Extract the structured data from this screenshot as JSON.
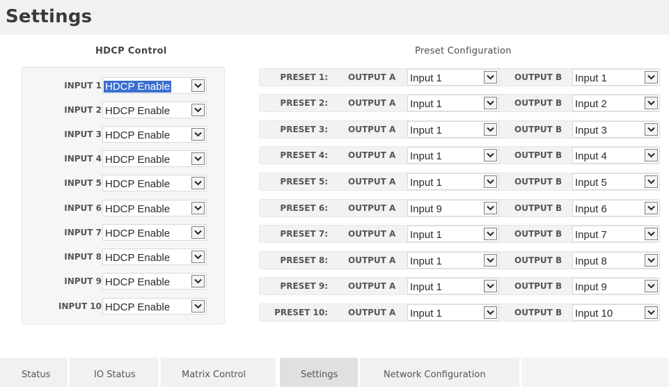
{
  "page": {
    "title": "Settings"
  },
  "hdcp": {
    "title": "HDCP Control",
    "rows": [
      {
        "label": "INPUT 1",
        "value": "HDCP Enable"
      },
      {
        "label": "INPUT 2",
        "value": "HDCP Enable"
      },
      {
        "label": "INPUT 3",
        "value": "HDCP Enable"
      },
      {
        "label": "INPUT 4",
        "value": "HDCP Enable"
      },
      {
        "label": "INPUT 5",
        "value": "HDCP Enable"
      },
      {
        "label": "INPUT 6",
        "value": "HDCP Enable"
      },
      {
        "label": "INPUT 7",
        "value": "HDCP Enable"
      },
      {
        "label": "INPUT 8",
        "value": "HDCP Enable"
      },
      {
        "label": "INPUT 9",
        "value": "HDCP Enable"
      },
      {
        "label": "INPUT 10",
        "value": "HDCP Enable"
      }
    ]
  },
  "preset": {
    "title": "Preset Configuration",
    "output_a_label": "OUTPUT A",
    "output_b_label": "OUTPUT B",
    "rows": [
      {
        "label": "PRESET 1:",
        "output_a": "Input 1",
        "output_b": "Input 1"
      },
      {
        "label": "PRESET 2:",
        "output_a": "Input 1",
        "output_b": "Input 2"
      },
      {
        "label": "PRESET 3:",
        "output_a": "Input 1",
        "output_b": "Input 3"
      },
      {
        "label": "PRESET 4:",
        "output_a": "Input 1",
        "output_b": "Input 4"
      },
      {
        "label": "PRESET 5:",
        "output_a": "Input 1",
        "output_b": "Input 5"
      },
      {
        "label": "PRESET 6:",
        "output_a": "Input 9",
        "output_b": "Input 6"
      },
      {
        "label": "PRESET 7:",
        "output_a": "Input 1",
        "output_b": "Input 7"
      },
      {
        "label": "PRESET 8:",
        "output_a": "Input 1",
        "output_b": "Input 8"
      },
      {
        "label": "PRESET 9:",
        "output_a": "Input 1",
        "output_b": "Input 9"
      },
      {
        "label": "PRESET 10:",
        "output_a": "Input 1",
        "output_b": "Input 10"
      }
    ]
  },
  "tabs": [
    {
      "label": "Status"
    },
    {
      "label": "IO Status"
    },
    {
      "label": "Matrix Control"
    },
    {
      "label": "Settings",
      "active": true
    },
    {
      "label": "Network Configuration"
    }
  ],
  "icons": {
    "dropdown": "chevron-down-icon"
  },
  "colors": {
    "selection": "#3a6fd1",
    "active_tab": "#e0e0e0"
  }
}
